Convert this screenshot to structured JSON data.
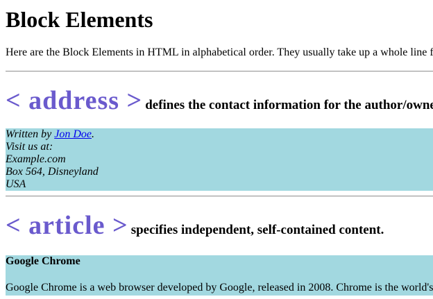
{
  "title": "Block Elements",
  "intro": "Here are the Block Elements in HTML in alphabetical order. They usually take up a whole line f",
  "sections": {
    "address": {
      "tag": "< address >",
      "description": "defines the contact information for the author/owne",
      "written_by_prefix": "Written by ",
      "author_link": "Jon Doe",
      "written_by_suffix": ".",
      "visit_line": "Visit us at:",
      "site": "Example.com",
      "box": "Box 564, Disneyland",
      "country": "USA"
    },
    "article": {
      "tag": "< article >",
      "description": "specifies independent, self-contained content.",
      "example_title": "Google Chrome",
      "example_text": "Google Chrome is a web browser developed by Google, released in 2008. Chrome is the world's"
    }
  }
}
